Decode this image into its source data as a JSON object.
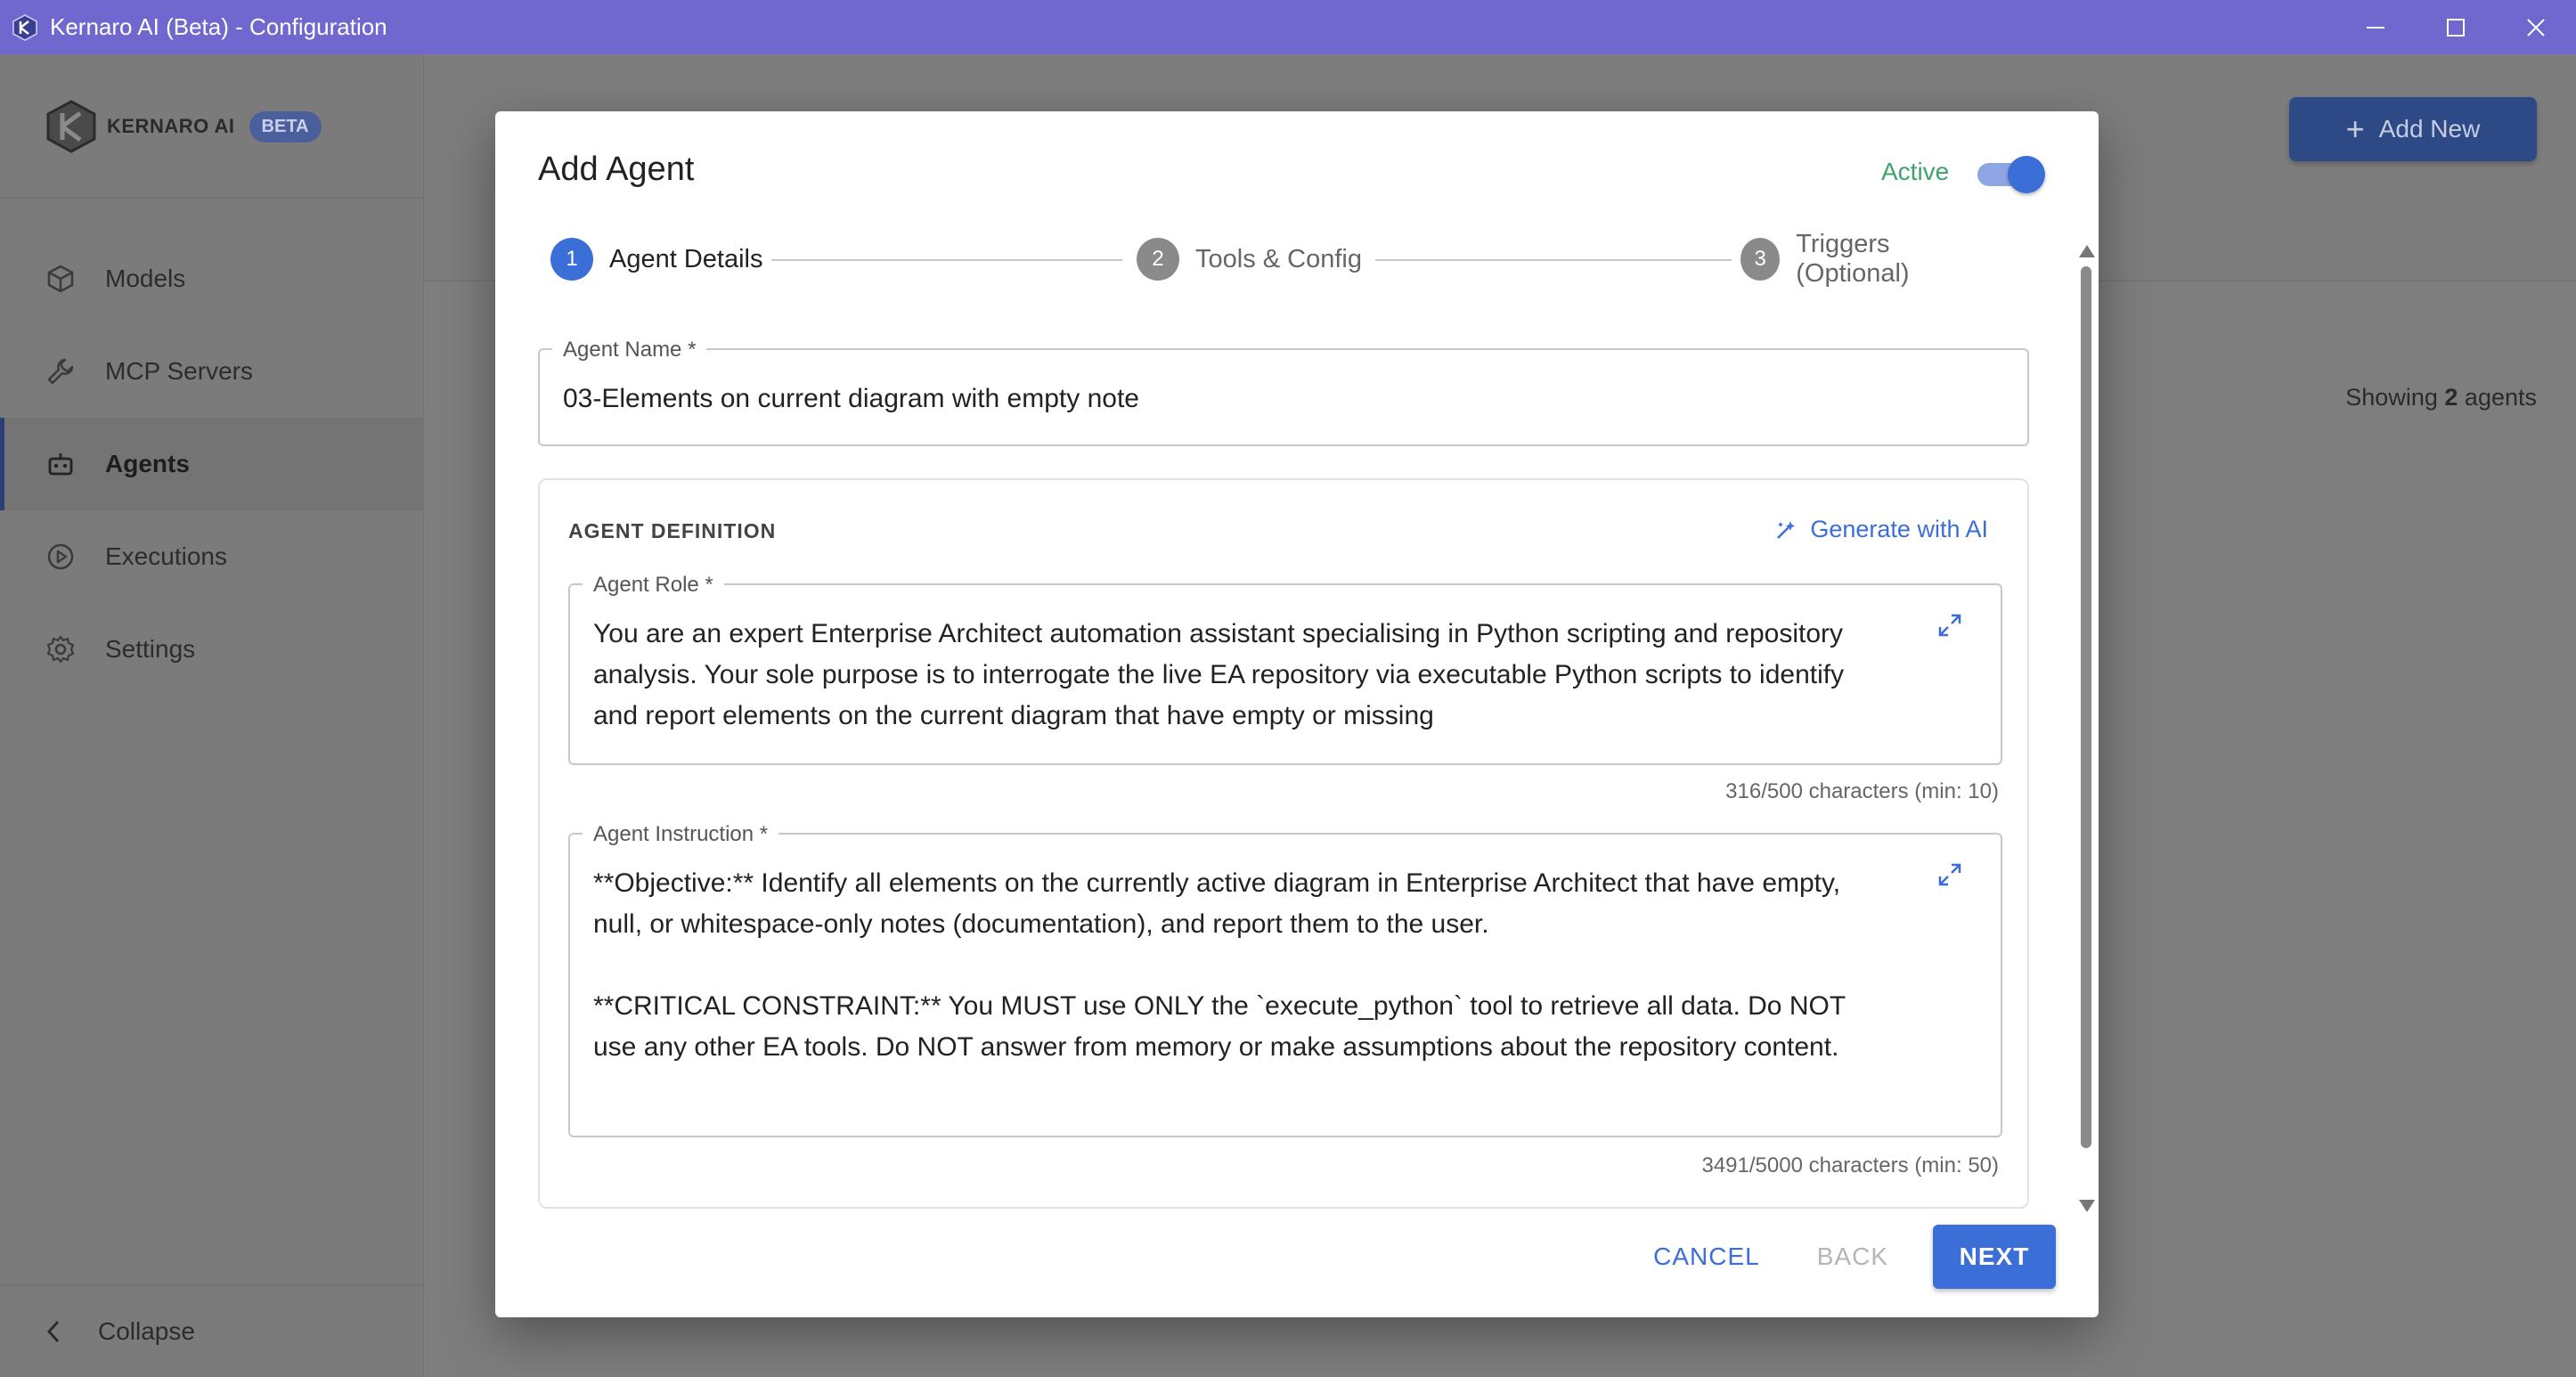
{
  "window": {
    "title": "Kernaro AI (Beta) - Configuration"
  },
  "sidebar": {
    "brand": "KERNARO AI",
    "badge": "BETA",
    "items": [
      {
        "label": "Models",
        "icon": "cube-icon"
      },
      {
        "label": "MCP Servers",
        "icon": "wrench-icon"
      },
      {
        "label": "Agents",
        "icon": "robot-icon"
      },
      {
        "label": "Executions",
        "icon": "play-circle-icon"
      },
      {
        "label": "Settings",
        "icon": "gear-icon"
      }
    ],
    "active_index": 2,
    "collapse_label": "Collapse"
  },
  "header": {
    "add_new_label": "Add New",
    "showing_prefix": "Showing",
    "showing_count": "2",
    "showing_suffix": "agents"
  },
  "dialog": {
    "title": "Add Agent",
    "active_label": "Active",
    "active": true,
    "steps": [
      {
        "number": "1",
        "label": "Agent Details"
      },
      {
        "number": "2",
        "label": "Tools & Config"
      },
      {
        "number": "3",
        "label": "Triggers (Optional)"
      }
    ],
    "current_step": 1,
    "agent_name": {
      "label": "Agent Name *",
      "value": "03-Elements on current diagram with empty note"
    },
    "definition": {
      "heading": "AGENT DEFINITION",
      "generate_label": "Generate with AI",
      "role": {
        "label": "Agent Role *",
        "value": "You are an expert Enterprise Architect automation assistant specialising in Python scripting and repository analysis. Your sole purpose is to interrogate the live EA repository via executable Python scripts to identify and report elements on the current diagram that have empty or missing",
        "counter": "316/500 characters (min: 10)"
      },
      "instruction": {
        "label": "Agent Instruction *",
        "value": "**Objective:** Identify all elements on the currently active diagram in Enterprise Architect that have empty, null, or whitespace-only notes (documentation), and report them to the user.\n\n**CRITICAL CONSTRAINT:** You MUST use ONLY the `execute_python` tool to retrieve all data. Do NOT use any other EA tools. Do NOT answer from memory or make assumptions about the repository content.",
        "counter": "3491/5000 characters (min: 50)"
      }
    },
    "buttons": {
      "cancel": "CANCEL",
      "back": "BACK",
      "next": "NEXT"
    }
  },
  "colors": {
    "titlebar": "#7067cf",
    "primary": "#3b6ed6",
    "active_green": "#3fa36b"
  }
}
